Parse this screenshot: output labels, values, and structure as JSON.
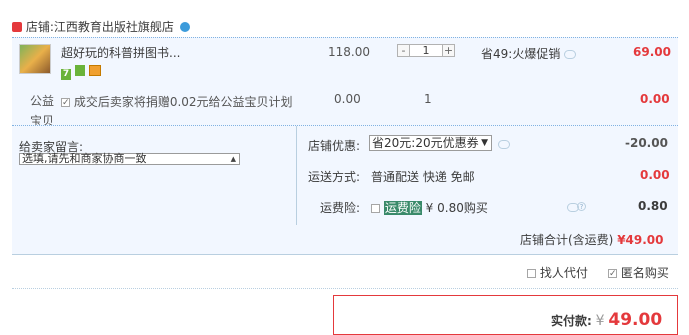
{
  "shop": {
    "label": "店铺:",
    "name": "江西教育出版社旗舰店"
  },
  "item": {
    "title": "超好玩的科普拼图书...",
    "price": "118.00",
    "quantity": "1",
    "promo": "省49:火爆促销",
    "total": "69.00",
    "badges": [
      "7",
      "phone-icon",
      "card-icon"
    ]
  },
  "charity": {
    "label": "公益",
    "text": "成交后卖家将捐赠0.02元给公益宝贝计划",
    "text2": "宝贝",
    "price": "0.00",
    "quantity": "1",
    "total": "0.00"
  },
  "message": {
    "label": "给卖家留言:",
    "placeholder": "选填,请先和商家协商一致"
  },
  "discount": {
    "label": "店铺优惠:",
    "selected": "省20元:20元优惠券",
    "amount": "-20.00"
  },
  "shipping": {
    "label": "运送方式:",
    "value": "普通配送 快递 免邮",
    "amount": "0.00"
  },
  "insurance": {
    "label": "运费险:",
    "highlight": "运费险",
    "text": "¥ 0.80购买",
    "amount": "0.80"
  },
  "subtotal": {
    "label": "店铺合计(含运费)",
    "amount": "¥49.00"
  },
  "options": {
    "proxy_pay": "找人代付",
    "anonymous": "匿名购买"
  },
  "payment": {
    "label": "实付款:",
    "currency": "¥",
    "amount": "49.00"
  },
  "colors": {
    "accent_red": "#e4393c",
    "panel_bg": "#f2f7ff",
    "border_blue": "#b9cfe0"
  }
}
